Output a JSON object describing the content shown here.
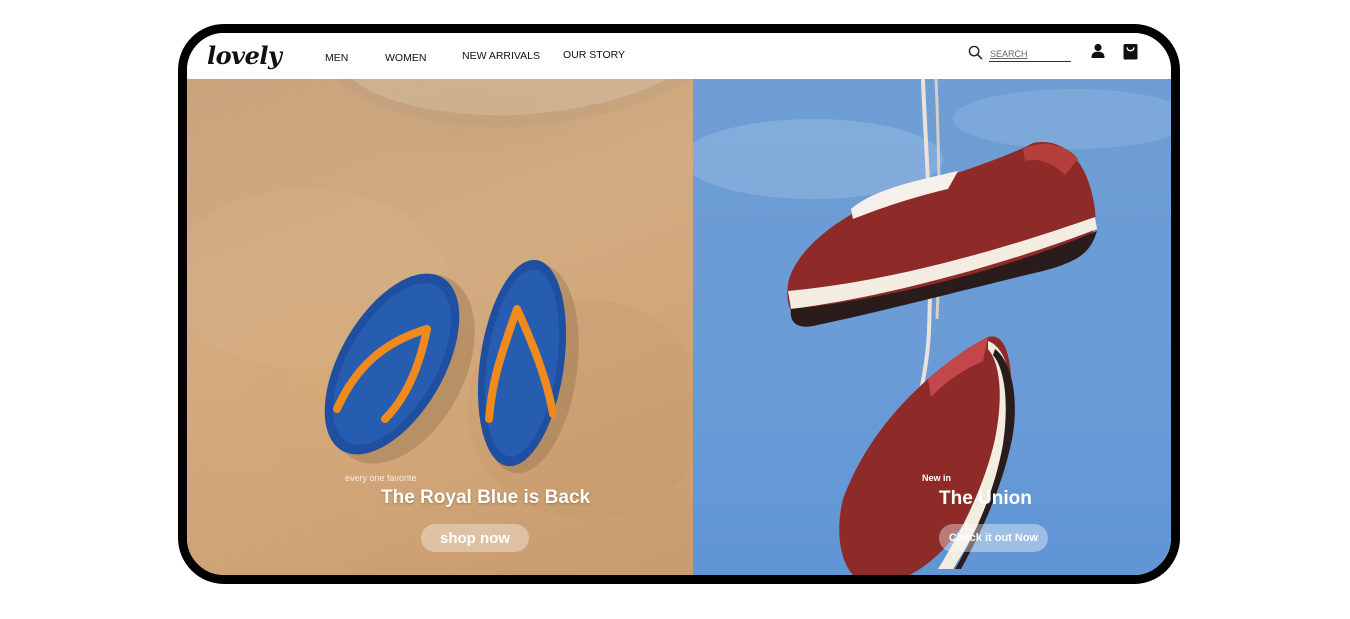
{
  "brand": {
    "logo_text": "lovely"
  },
  "nav": {
    "items": [
      {
        "label": "MEN"
      },
      {
        "label": "WOMEN"
      },
      {
        "label": "NEW ARRIVALS"
      },
      {
        "label": "OUR STORY"
      }
    ]
  },
  "search": {
    "placeholder": "SEARCH",
    "icon": "search-icon"
  },
  "header_icons": {
    "account": "user-icon",
    "cart": "shopping-bag-icon"
  },
  "hero_left": {
    "eyebrow": "every one favorite",
    "title": "The Royal Blue is Back",
    "cta": "shop now"
  },
  "hero_right": {
    "eyebrow": "New in",
    "title": "The Union",
    "cta": "Check it out Now"
  },
  "colors": {
    "frame": "#000000",
    "sand": "#cfa477",
    "sky": "#6a9bd6",
    "flipflop_blue": "#1f4fa0",
    "strap_orange": "#f08a1c",
    "shoe_red": "#8e2a28"
  }
}
